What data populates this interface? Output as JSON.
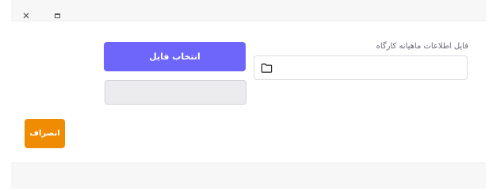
{
  "window": {
    "close_glyph": "✕",
    "controls": [
      "close-icon",
      "maximize-icon"
    ]
  },
  "form": {
    "field_label": "فایل اطلاعات ماهیانه کارگاه",
    "file_input_icon": "folder-icon",
    "choose_file_label": "انتخاب فایل",
    "selected_file_value": ""
  },
  "actions": {
    "cancel_label": "انصراف"
  },
  "colors": {
    "primary": "#6e66fb",
    "warning": "#f08b04"
  }
}
